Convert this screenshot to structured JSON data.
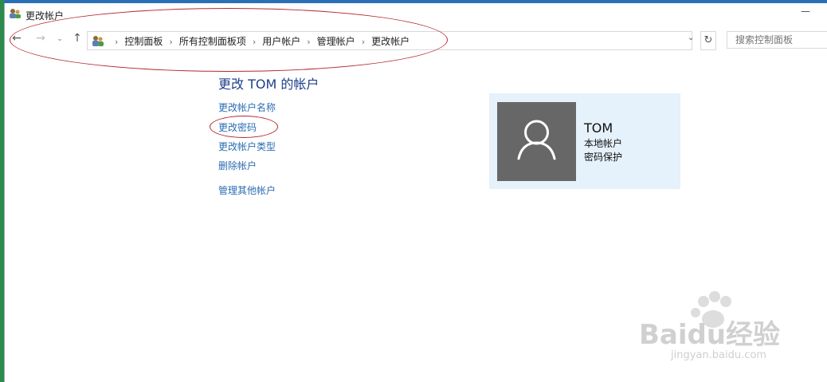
{
  "window": {
    "title": "更改帐户"
  },
  "navigation": {
    "breadcrumbs": [
      "控制面板",
      "所有控制面板项",
      "用户帐户",
      "管理帐户",
      "更改帐户"
    ],
    "search_placeholder": "搜索控制面板"
  },
  "main": {
    "heading": "更改 TOM 的帐户",
    "links": [
      "更改帐户名称",
      "更改密码",
      "更改帐户类型",
      "删除帐户",
      "管理其他帐户"
    ]
  },
  "account": {
    "name": "TOM",
    "type": "本地帐户",
    "protection": "密码保护"
  },
  "watermark": {
    "brand": "Baidu经验",
    "url": "jingyan.baidu.com"
  },
  "colors": {
    "link": "#2b6cb3",
    "heading": "#1e3f8c",
    "card_bg": "#e5f1fb",
    "annotation": "#b4262e"
  }
}
